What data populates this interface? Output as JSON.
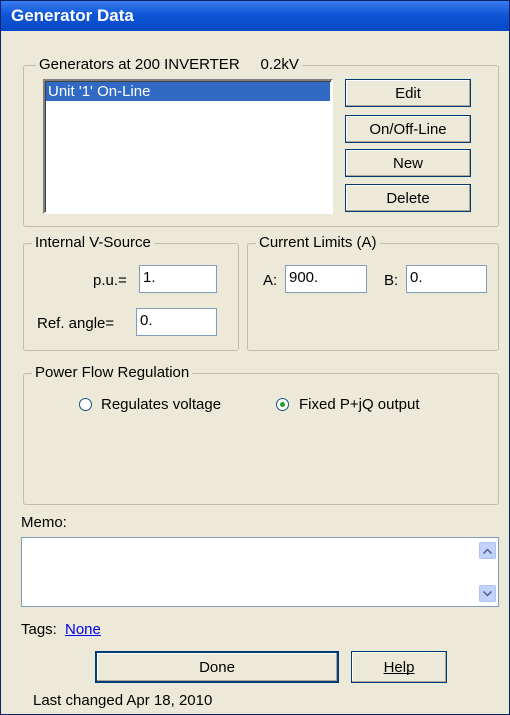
{
  "window": {
    "title": "Generator Data"
  },
  "generators": {
    "heading": "Generators at  200 INVERTER",
    "voltage": "0.2kV",
    "items": [
      "Unit '1'  On-Line"
    ],
    "buttons": {
      "edit": "Edit",
      "onoff": "On/Off-Line",
      "new": "New",
      "delete": "Delete"
    }
  },
  "internal_source": {
    "title": "Internal V-Source",
    "pu_label": "p.u.=",
    "pu_value": "1.",
    "angle_label": "Ref. angle=",
    "angle_value": "0."
  },
  "current_limits": {
    "title": "Current Limits (A)",
    "a_label": "A:",
    "a_value": "900.",
    "b_label": "B:",
    "b_value": "0."
  },
  "power_flow": {
    "title": "Power Flow Regulation",
    "option_voltage": "Regulates voltage",
    "option_fixed": "Fixed P+jQ output",
    "selected": "Fixed P+jQ output"
  },
  "memo": {
    "label": "Memo:",
    "value": ""
  },
  "tags": {
    "label": "Tags:",
    "link": "None"
  },
  "footer": {
    "done": "Done",
    "help": "Help",
    "last_changed": "Last changed Apr 18, 2010"
  }
}
